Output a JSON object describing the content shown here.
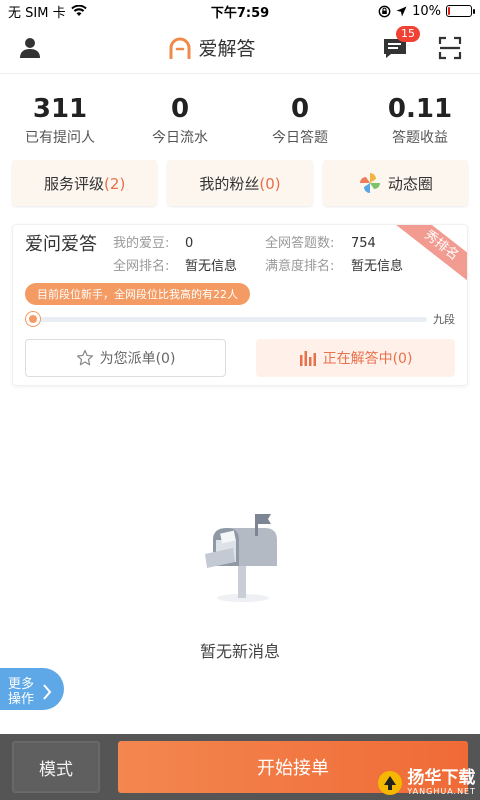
{
  "status": {
    "carrier": "无 SIM 卡",
    "time": "下午7:59",
    "battery": "10%",
    "battery_level": 0.1
  },
  "header": {
    "title": "爱解答",
    "message_badge": "15"
  },
  "stats": [
    {
      "value": "311",
      "label": "已有提问人"
    },
    {
      "value": "0",
      "label": "今日流水"
    },
    {
      "value": "0",
      "label": "今日答题"
    },
    {
      "value": "0.11",
      "label": "答题收益"
    }
  ],
  "quick": {
    "rating_label": "服务评级",
    "rating_count": "(2)",
    "fans_label": "我的粉丝",
    "fans_count": "(0)",
    "moments_label": "动态圈"
  },
  "card": {
    "title": "爱问爱答",
    "ribbon": "秀排名",
    "beans_label": "我的爱豆:",
    "beans_value": "0",
    "total_answers_label": "全网答题数:",
    "total_answers_value": "754",
    "rank_label": "全网排名:",
    "rank_value": "暂无信息",
    "satisfaction_label": "满意度排名:",
    "satisfaction_value": "暂无信息",
    "tip": "目前段位新手，全网段位比我高的有22人",
    "level_label": "九段",
    "progress": 0.02,
    "dispatch_label": "为您派单(0)",
    "answering_label": "正在解答中(0)"
  },
  "empty": {
    "text": "暂无新消息"
  },
  "more": {
    "line1": "更多",
    "line2": "操作"
  },
  "bottom": {
    "mode_label": "模式",
    "start_label": "开始接单"
  },
  "watermark": {
    "brand": "扬华下载",
    "url": "YANGHUA.NET"
  },
  "colors": {
    "accent": "#f06a36",
    "badge": "#f04134",
    "more_button": "#5fa8e8"
  }
}
